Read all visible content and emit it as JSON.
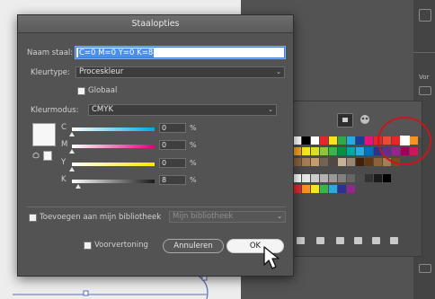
{
  "dialog": {
    "title": "Staalopties",
    "name_label": "Naam staal:",
    "name_value": "C=0 M=0 Y=0 K=8",
    "color_type_label": "Kleurtype:",
    "color_type_value": "Proceskleur",
    "global_label": "Globaal",
    "color_mode_label": "Kleurmodus:",
    "color_mode_value": "CMYK",
    "sliders": [
      {
        "label": "C",
        "value": "0",
        "unit": "%",
        "level": 0.0
      },
      {
        "label": "M",
        "value": "0",
        "unit": "%",
        "level": 0.0
      },
      {
        "label": "Y",
        "value": "0",
        "unit": "%",
        "level": 0.0
      },
      {
        "label": "K",
        "value": "8",
        "unit": "%",
        "level": 0.08
      }
    ],
    "library_label": "Toevoegen aan mijn bibliotheek",
    "library_value": "Mijn bibliotheek",
    "preview_label": "Voorvertoning",
    "cancel_label": "Annuleren",
    "ok_label": "OK"
  },
  "sidebar": {
    "partial_label": "Vor"
  },
  "colors": {
    "dialog_bg": "#535353",
    "accent_blue": "#4a8fe8",
    "highlight_ellipse": "#c9161d"
  }
}
